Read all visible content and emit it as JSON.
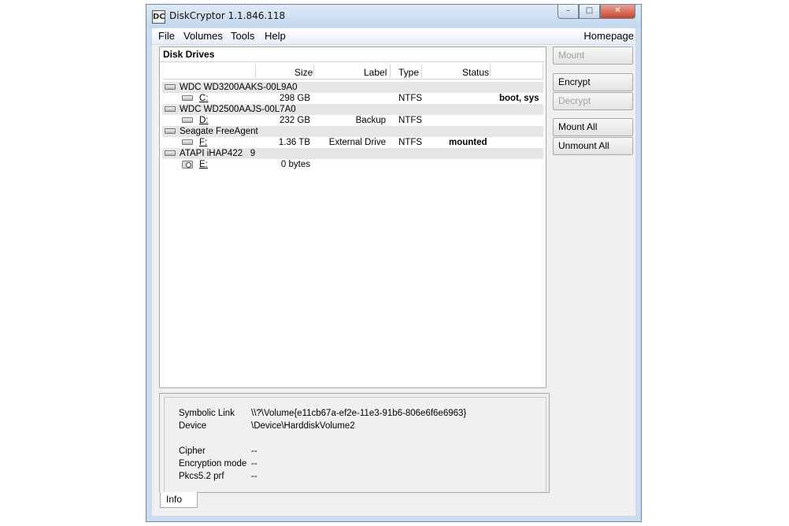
{
  "window": {
    "title": "DiskCryptor 1.1.846.118",
    "icon": "dc-app-icon",
    "controls": {
      "minimize": "–",
      "maximize": "□",
      "close": "✕"
    }
  },
  "menu": {
    "items": [
      "File",
      "Volumes",
      "Tools",
      "Help"
    ],
    "homepage": "Homepage"
  },
  "drives": {
    "title": "Disk Drives",
    "columns": [
      "Size",
      "Label",
      "Type",
      "Status"
    ],
    "rows": [
      {
        "kind": "disk",
        "name": "WDC WD3200AAKS-00L9A0"
      },
      {
        "kind": "volume",
        "name": "C:",
        "size": "298 GB",
        "label": "",
        "type": "NTFS",
        "status": "boot, sys"
      },
      {
        "kind": "disk",
        "name": "WDC WD2500AAJS-00L7A0"
      },
      {
        "kind": "volume",
        "name": "D:",
        "size": "232 GB",
        "label": "Backup",
        "type": "NTFS",
        "status": ""
      },
      {
        "kind": "disk",
        "name": "Seagate FreeAgent"
      },
      {
        "kind": "volume",
        "name": "F:",
        "size": "1.36 TB",
        "label": "External Drive",
        "type": "NTFS",
        "status": "mounted"
      },
      {
        "kind": "disk",
        "name": "ATAPI iHAP422   9"
      },
      {
        "kind": "cdrom",
        "name": "E:",
        "size": "0 bytes",
        "label": "",
        "type": "",
        "status": ""
      }
    ]
  },
  "buttons": {
    "mount": "Mount",
    "encrypt": "Encrypt",
    "decrypt": "Decrypt",
    "mount_all": "Mount All",
    "unmount_all": "Unmount All"
  },
  "info": {
    "tab": "Info",
    "symbolic_link_label": "Symbolic Link",
    "symbolic_link_value": "\\\\?\\Volume{e11cb67a-ef2e-11e3-91b6-806e6f6e6963}",
    "device_label": "Device",
    "device_value": "\\Device\\HarddiskVolume2",
    "cipher_label": "Cipher",
    "cipher_value": "--",
    "mode_label": "Encryption mode",
    "mode_value": "--",
    "prf_label": "Pkcs5.2 prf",
    "prf_value": "--"
  }
}
